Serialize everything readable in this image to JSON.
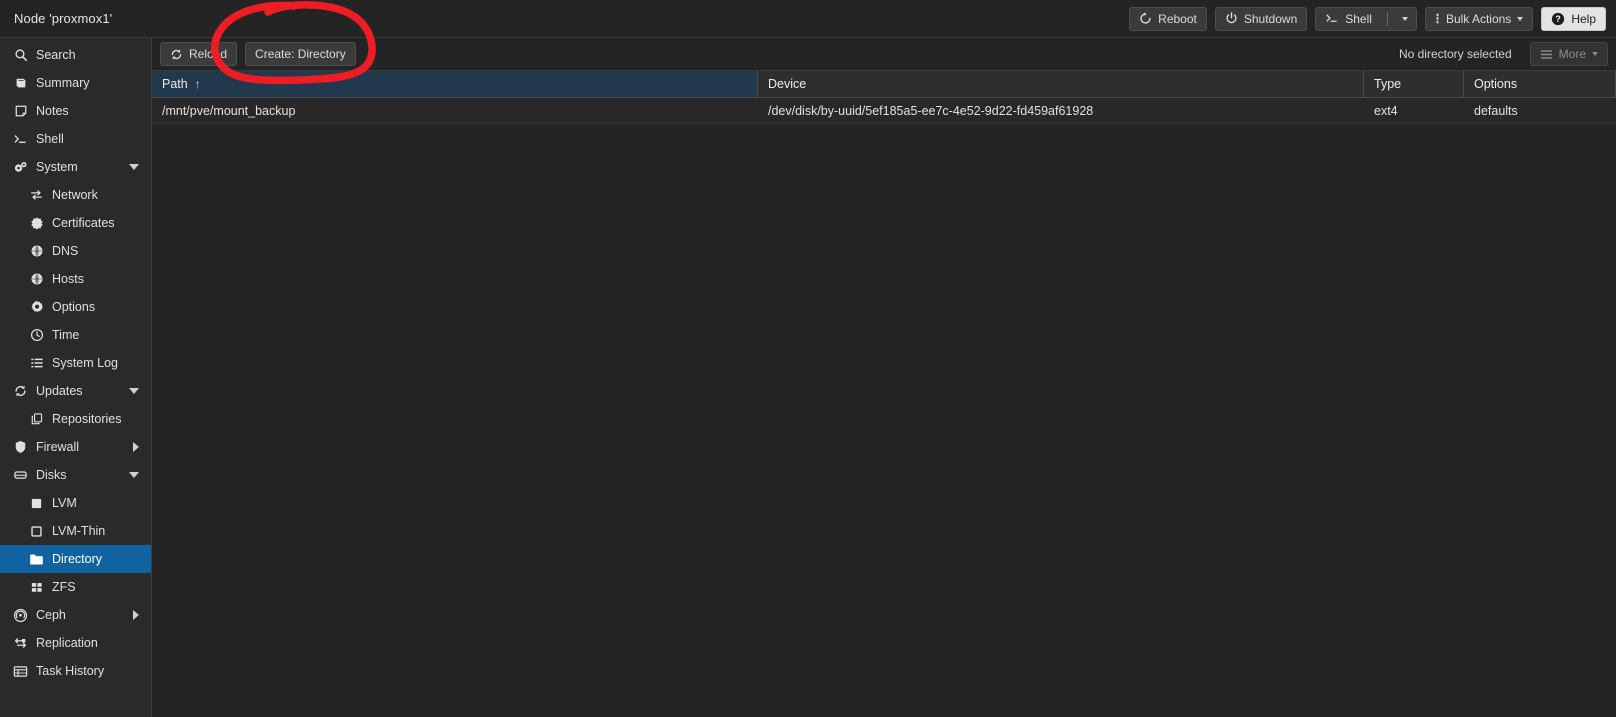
{
  "header": {
    "node_title": "Node 'proxmox1'",
    "buttons": [
      {
        "label": "Reboot",
        "icon": "reboot-icon",
        "style": "dark",
        "split": false
      },
      {
        "label": "Shutdown",
        "icon": "power-icon",
        "style": "dark",
        "split": false
      },
      {
        "label": "Shell",
        "icon": "terminal-icon",
        "style": "dark",
        "split": true
      },
      {
        "label": "Bulk Actions",
        "icon": "kebab-menu-icon",
        "style": "dark",
        "split": false,
        "caret": true
      },
      {
        "label": "Help",
        "icon": "question-mark-icon",
        "style": "light",
        "split": false
      }
    ]
  },
  "sidebar": {
    "items": [
      {
        "label": "Search",
        "icon": "search-icon",
        "level": 0,
        "arrow": "none",
        "selected": false
      },
      {
        "label": "Summary",
        "icon": "summary-icon",
        "level": 0,
        "arrow": "none",
        "selected": false
      },
      {
        "label": "Notes",
        "icon": "notes-icon",
        "level": 0,
        "arrow": "none",
        "selected": false
      },
      {
        "label": "Shell",
        "icon": "terminal-icon",
        "level": 0,
        "arrow": "none",
        "selected": false
      },
      {
        "label": "System",
        "icon": "gears-icon",
        "level": 0,
        "arrow": "down",
        "selected": false
      },
      {
        "label": "Network",
        "icon": "network-icon",
        "level": 1,
        "arrow": "none",
        "selected": false
      },
      {
        "label": "Certificates",
        "icon": "certificate-icon",
        "level": 1,
        "arrow": "none",
        "selected": false
      },
      {
        "label": "DNS",
        "icon": "globe-icon",
        "level": 1,
        "arrow": "none",
        "selected": false
      },
      {
        "label": "Hosts",
        "icon": "globe-icon",
        "level": 1,
        "arrow": "none",
        "selected": false
      },
      {
        "label": "Options",
        "icon": "gear-icon",
        "level": 1,
        "arrow": "none",
        "selected": false
      },
      {
        "label": "Time",
        "icon": "clock-icon",
        "level": 1,
        "arrow": "none",
        "selected": false
      },
      {
        "label": "System Log",
        "icon": "list-icon",
        "level": 1,
        "arrow": "none",
        "selected": false
      },
      {
        "label": "Updates",
        "icon": "refresh-icon",
        "level": 0,
        "arrow": "down",
        "selected": false
      },
      {
        "label": "Repositories",
        "icon": "copy-icon",
        "level": 1,
        "arrow": "none",
        "selected": false
      },
      {
        "label": "Firewall",
        "icon": "shield-icon",
        "level": 0,
        "arrow": "right",
        "selected": false
      },
      {
        "label": "Disks",
        "icon": "disk-icon",
        "level": 0,
        "arrow": "down",
        "selected": false
      },
      {
        "label": "LVM",
        "icon": "square-filled-icon",
        "level": 1,
        "arrow": "none",
        "selected": false
      },
      {
        "label": "LVM-Thin",
        "icon": "square-outline-icon",
        "level": 1,
        "arrow": "none",
        "selected": false
      },
      {
        "label": "Directory",
        "icon": "folder-icon",
        "level": 1,
        "arrow": "none",
        "selected": true
      },
      {
        "label": "ZFS",
        "icon": "grid-icon",
        "level": 1,
        "arrow": "none",
        "selected": false
      },
      {
        "label": "Ceph",
        "icon": "ceph-icon",
        "level": 0,
        "arrow": "right",
        "selected": false
      },
      {
        "label": "Replication",
        "icon": "replication-icon",
        "level": 0,
        "arrow": "none",
        "selected": false
      },
      {
        "label": "Task History",
        "icon": "table-icon",
        "level": 0,
        "arrow": "none",
        "selected": false
      }
    ]
  },
  "toolbar": {
    "reload_label": "Reload",
    "create_label": "Create: Directory",
    "status_text": "No directory selected",
    "more_label": "More"
  },
  "grid": {
    "columns": [
      {
        "key": "path",
        "label": "Path",
        "sorted": true,
        "sort_arrow": "↑"
      },
      {
        "key": "device",
        "label": "Device",
        "sorted": false,
        "sort_arrow": ""
      },
      {
        "key": "type",
        "label": "Type",
        "sorted": false,
        "sort_arrow": ""
      },
      {
        "key": "options",
        "label": "Options",
        "sorted": false,
        "sort_arrow": ""
      }
    ],
    "rows": [
      {
        "path": "/mnt/pve/mount_backup",
        "device": "/dev/disk/by-uuid/5ef185a5-ee7c-4e52-9d22-fd459af61928",
        "type": "ext4",
        "options": "defaults"
      }
    ]
  },
  "annotation": {
    "shape": "hand-drawn-ellipse",
    "color": "#ee1c24",
    "target": "Create: Directory"
  },
  "colors": {
    "accent_selection": "#1063a0",
    "sorted_header": "#22384d",
    "annotation_red": "#ee1c24",
    "background": "#242424",
    "sidebar_background": "#2a2a2a"
  }
}
